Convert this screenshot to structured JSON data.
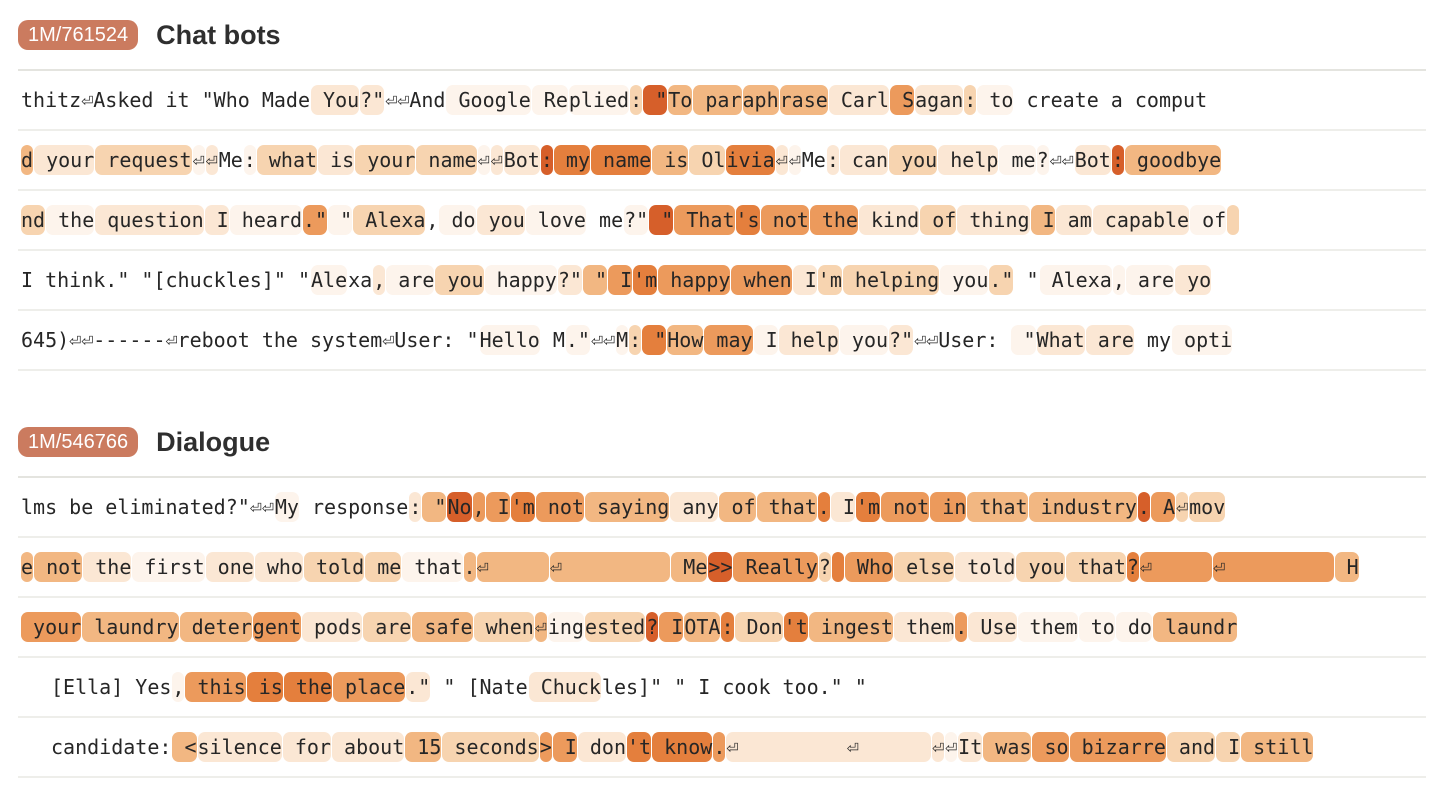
{
  "sections": [
    {
      "badge": "1M/761524",
      "title": "Chat bots",
      "rows": [
        {
          "indent": 0,
          "tokens": [
            [
              "thitz⏎Asked it \"Who Made",
              0
            ],
            [
              " You",
              2
            ],
            [
              "?\"",
              2
            ],
            [
              "⏎⏎And",
              0
            ],
            [
              " Google",
              1
            ],
            [
              " Re",
              1
            ],
            [
              "plied",
              1
            ],
            [
              ":",
              3
            ],
            [
              " \"",
              7
            ],
            [
              "To",
              4
            ],
            [
              " par",
              4
            ],
            [
              "aph",
              4
            ],
            [
              "rase",
              4
            ],
            [
              " Carl",
              2
            ],
            [
              " S",
              5
            ],
            [
              "agan",
              2
            ],
            [
              ":",
              3
            ],
            [
              " to",
              1
            ],
            [
              " create a comput",
              0
            ]
          ]
        },
        {
          "indent": 0,
          "tokens": [
            [
              "d",
              4
            ],
            [
              " your",
              2
            ],
            [
              " request",
              3
            ],
            [
              "⏎",
              1
            ],
            [
              "⏎",
              2
            ],
            [
              "Me",
              0
            ],
            [
              ":",
              1
            ],
            [
              " what",
              3
            ],
            [
              " is",
              2
            ],
            [
              " your",
              3
            ],
            [
              " name",
              3
            ],
            [
              "⏎",
              1
            ],
            [
              "⏎",
              2
            ],
            [
              "Bot",
              2
            ],
            [
              ":",
              7
            ],
            [
              " my",
              6
            ],
            [
              " name",
              6
            ],
            [
              " is",
              4
            ],
            [
              " Ol",
              3
            ],
            [
              "ivia",
              6
            ],
            [
              "⏎",
              2
            ],
            [
              "⏎",
              1
            ],
            [
              "Me",
              0
            ],
            [
              ":",
              2
            ],
            [
              " can",
              2
            ],
            [
              " you",
              3
            ],
            [
              " help",
              2
            ],
            [
              " me",
              1
            ],
            [
              "?",
              1
            ],
            [
              "⏎⏎",
              0
            ],
            [
              "Bot",
              2
            ],
            [
              ":",
              7
            ],
            [
              " goodbye",
              4
            ]
          ]
        },
        {
          "indent": 0,
          "tokens": [
            [
              "nd",
              3
            ],
            [
              " the",
              1
            ],
            [
              " question",
              2
            ],
            [
              " I",
              2
            ],
            [
              " heard",
              1
            ],
            [
              ".\"",
              5
            ],
            [
              " \"",
              1
            ],
            [
              " Alexa",
              3
            ],
            [
              ",",
              0
            ],
            [
              " do",
              1
            ],
            [
              " you",
              2
            ],
            [
              " love",
              1
            ],
            [
              " me",
              0
            ],
            [
              "?\"",
              1
            ],
            [
              " \"",
              7
            ],
            [
              " That",
              5
            ],
            [
              "'s",
              6
            ],
            [
              " not",
              5
            ],
            [
              " the",
              5
            ],
            [
              " kind",
              2
            ],
            [
              " of",
              3
            ],
            [
              " thing",
              2
            ],
            [
              " I",
              4
            ],
            [
              " am",
              2
            ],
            [
              " capable",
              2
            ],
            [
              " of",
              1
            ],
            [
              " ",
              3
            ]
          ]
        },
        {
          "indent": 0,
          "tokens": [
            [
              "I think.\" \"[chuckles]\" \"",
              0
            ],
            [
              "Ale",
              1
            ],
            [
              "xa",
              0
            ],
            [
              ",",
              2
            ],
            [
              " are",
              1
            ],
            [
              " you",
              3
            ],
            [
              " happy",
              1
            ],
            [
              "?\"",
              2
            ],
            [
              " \"",
              4
            ],
            [
              " I",
              5
            ],
            [
              "'m",
              6
            ],
            [
              " happy",
              5
            ],
            [
              " when",
              5
            ],
            [
              " I",
              2
            ],
            [
              "'m",
              3
            ],
            [
              " helping",
              3
            ],
            [
              " you",
              1
            ],
            [
              ".\"",
              3
            ],
            [
              " \"",
              0
            ],
            [
              " Alexa",
              1
            ],
            [
              ",",
              1
            ],
            [
              " are",
              1
            ],
            [
              " yo",
              2
            ]
          ]
        },
        {
          "indent": 0,
          "tokens": [
            [
              "645)⏎⏎------⏎reboot the system⏎User: \"",
              0
            ],
            [
              "Hello",
              1
            ],
            [
              " M",
              0
            ],
            [
              ".\"",
              1
            ],
            [
              "⏎⏎",
              0
            ],
            [
              "M",
              1
            ],
            [
              ":",
              3
            ],
            [
              " \"",
              6
            ],
            [
              "How",
              4
            ],
            [
              " may",
              5
            ],
            [
              " I",
              1
            ],
            [
              " help",
              2
            ],
            [
              " you",
              1
            ],
            [
              "?\"",
              2
            ],
            [
              "⏎⏎User: ",
              0
            ],
            [
              " \"",
              1
            ],
            [
              "What",
              2
            ],
            [
              " are",
              2
            ],
            [
              " my",
              0
            ],
            [
              " opti",
              1
            ]
          ]
        }
      ]
    },
    {
      "badge": "1M/546766",
      "title": "Dialogue",
      "rows": [
        {
          "indent": 0,
          "tokens": [
            [
              "lms be eliminated?\"⏎⏎",
              0
            ],
            [
              "My",
              1
            ],
            [
              " response",
              0
            ],
            [
              ":",
              2
            ],
            [
              " \"",
              4
            ],
            [
              "No",
              7
            ],
            [
              ",",
              5
            ],
            [
              " I",
              5
            ],
            [
              "'m",
              6
            ],
            [
              " not",
              5
            ],
            [
              " saying",
              4
            ],
            [
              " any",
              2
            ],
            [
              " of",
              4
            ],
            [
              " that",
              4
            ],
            [
              ".",
              6
            ],
            [
              " I",
              2
            ],
            [
              "'m",
              6
            ],
            [
              " not",
              5
            ],
            [
              " in",
              5
            ],
            [
              " that",
              4
            ],
            [
              " industry",
              4
            ],
            [
              ".",
              7
            ],
            [
              " A",
              5
            ],
            [
              "⏎",
              3
            ],
            [
              "mov",
              3
            ]
          ]
        },
        {
          "indent": 0,
          "tokens": [
            [
              "e",
              4
            ],
            [
              " not",
              4
            ],
            [
              " the",
              2
            ],
            [
              " first",
              1
            ],
            [
              " one",
              2
            ],
            [
              " who",
              2
            ],
            [
              " told",
              3
            ],
            [
              " me",
              3
            ],
            [
              " that",
              1
            ],
            [
              ".",
              4
            ],
            [
              "⏎     ",
              4
            ],
            [
              "⏎         ",
              4
            ],
            [
              " Me",
              4
            ],
            [
              ">>",
              7
            ],
            [
              " Really",
              5
            ],
            [
              "?",
              3
            ],
            [
              " ",
              6
            ],
            [
              " Who",
              5
            ],
            [
              " else",
              3
            ],
            [
              " told",
              2
            ],
            [
              " you",
              3
            ],
            [
              " that",
              3
            ],
            [
              "?",
              6
            ],
            [
              "⏎     ",
              5
            ],
            [
              "⏎         ",
              5
            ],
            [
              " H",
              4
            ]
          ]
        },
        {
          "indent": 0,
          "tokens": [
            [
              " your",
              5
            ],
            [
              " laundry",
              4
            ],
            [
              " deter",
              4
            ],
            [
              "gent",
              5
            ],
            [
              " pods",
              2
            ],
            [
              " are",
              3
            ],
            [
              " safe",
              4
            ],
            [
              " when",
              3
            ],
            [
              "⏎",
              4
            ],
            [
              "ing",
              1
            ],
            [
              "ested",
              3
            ],
            [
              "?",
              7
            ],
            [
              " I",
              5
            ],
            [
              "OTA",
              4
            ],
            [
              ":",
              6
            ],
            [
              " Don",
              3
            ],
            [
              "'t",
              6
            ],
            [
              " ingest",
              4
            ],
            [
              " them",
              2
            ],
            [
              ".",
              5
            ],
            [
              " Use",
              2
            ],
            [
              " them",
              1
            ],
            [
              " to",
              1
            ],
            [
              " do",
              1
            ],
            [
              " laundr",
              4
            ]
          ]
        },
        {
          "indent": 1,
          "tokens": [
            [
              "[Ella] Yes",
              0
            ],
            [
              ",",
              1
            ],
            [
              " this",
              5
            ],
            [
              " is",
              6
            ],
            [
              " the",
              6
            ],
            [
              " place",
              5
            ],
            [
              ".\"",
              2
            ],
            [
              " \" [Nate",
              0
            ],
            [
              " Chuck",
              2
            ],
            [
              "les]\" \" I cook too.\" \"",
              0
            ]
          ]
        },
        {
          "indent": 1,
          "tokens": [
            [
              "candidate:",
              0
            ],
            [
              " <",
              4
            ],
            [
              "silence",
              2
            ],
            [
              " for",
              2
            ],
            [
              " about",
              2
            ],
            [
              " 15",
              4
            ],
            [
              " seconds",
              3
            ],
            [
              ">",
              5
            ],
            [
              " I",
              5
            ],
            [
              " don",
              2
            ],
            [
              "'t",
              6
            ],
            [
              " know",
              6
            ],
            [
              ".",
              5
            ],
            [
              "⏎         ⏎      ",
              2
            ],
            [
              "⏎",
              2
            ],
            [
              "⏎",
              1
            ],
            [
              "It",
              2
            ],
            [
              " was",
              4
            ],
            [
              " so",
              5
            ],
            [
              " bizarre",
              5
            ],
            [
              " and",
              3
            ],
            [
              " I",
              3
            ],
            [
              " still",
              4
            ]
          ]
        }
      ]
    }
  ]
}
